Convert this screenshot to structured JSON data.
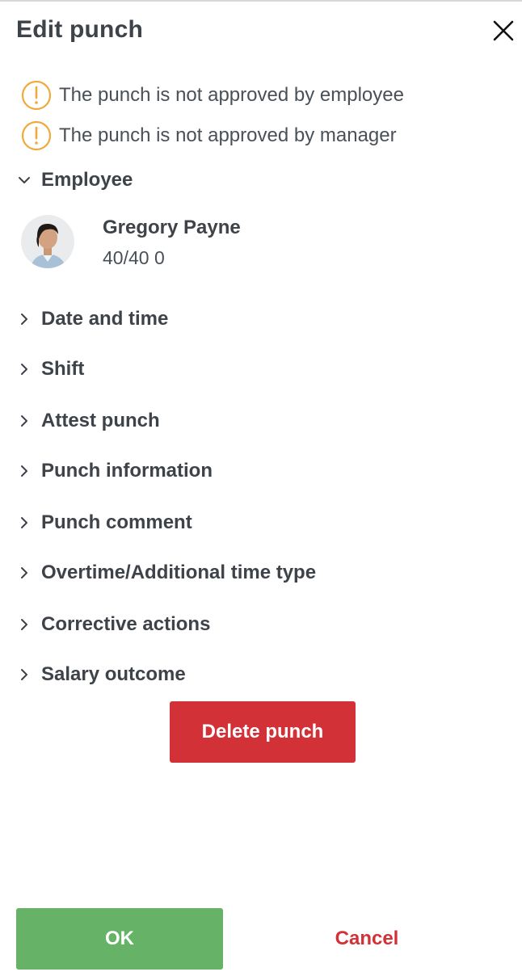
{
  "dialog": {
    "title": "Edit punch"
  },
  "warnings": [
    "The punch is not approved by employee",
    "The punch is not approved by manager"
  ],
  "employee_section": {
    "label": "Employee",
    "name": "Gregory Payne",
    "hours": "40/40 0"
  },
  "sections": [
    "Date and time",
    "Shift",
    "Attest punch",
    "Punch information",
    "Punch comment",
    "Overtime/Additional time type",
    "Corrective actions",
    "Salary outcome"
  ],
  "actions": {
    "delete_label": "Delete punch",
    "ok_label": "OK",
    "cancel_label": "Cancel"
  },
  "colors": {
    "warning": "#f0a93b",
    "danger": "#d23237",
    "success": "#66b266",
    "text": "#3d4349"
  },
  "icons": {
    "close": "close-icon",
    "warning": "exclamation-circle-icon",
    "expanded": "chevron-down-icon",
    "collapsed": "chevron-right-icon"
  }
}
